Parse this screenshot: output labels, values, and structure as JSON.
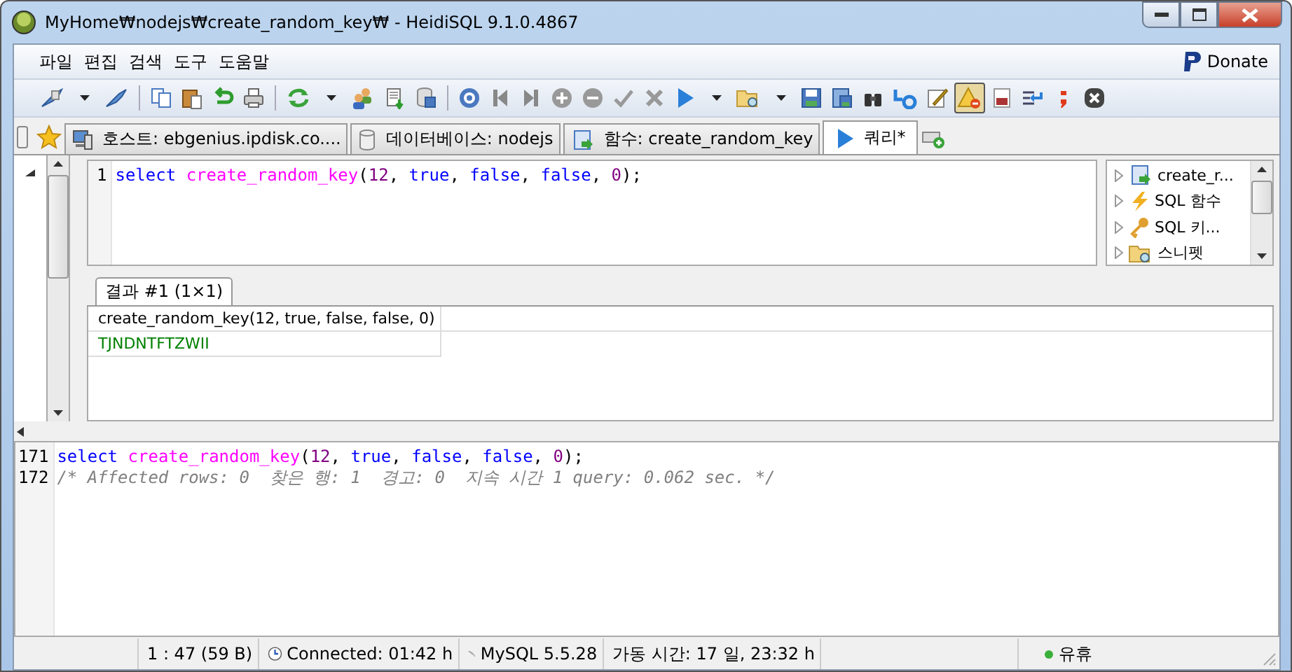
{
  "window": {
    "title": "MyHome₩nodejs₩create_random_key₩ - HeidiSQL 9.1.0.4867"
  },
  "menu": [
    "파일",
    "편집",
    "검색",
    "도구",
    "도움말"
  ],
  "donate": "Donate",
  "toolbar": [
    {
      "kind": "connect",
      "pressed": false
    },
    {
      "kind": "dropdown",
      "pressed": false
    },
    {
      "kind": "disconnect",
      "pressed": false
    },
    {
      "kind": "separator"
    },
    {
      "kind": "copy",
      "pressed": false
    },
    {
      "kind": "paste",
      "pressed": false
    },
    {
      "kind": "undo",
      "pressed": false
    },
    {
      "kind": "print",
      "pressed": false
    },
    {
      "kind": "separator"
    },
    {
      "kind": "refresh",
      "pressed": false
    },
    {
      "kind": "dropdown",
      "pressed": false
    },
    {
      "kind": "users",
      "pressed": false
    },
    {
      "kind": "export",
      "pressed": false
    },
    {
      "kind": "import",
      "pressed": false
    },
    {
      "kind": "separator"
    },
    {
      "kind": "help",
      "pressed": false
    },
    {
      "kind": "first",
      "pressed": false
    },
    {
      "kind": "last",
      "pressed": false
    },
    {
      "kind": "add",
      "pressed": false
    },
    {
      "kind": "remove",
      "pressed": false
    },
    {
      "kind": "check",
      "pressed": false
    },
    {
      "kind": "cancel",
      "pressed": false
    },
    {
      "kind": "run",
      "pressed": false
    },
    {
      "kind": "dropdown",
      "pressed": false
    },
    {
      "kind": "folder",
      "pressed": false
    },
    {
      "kind": "dropdown",
      "pressed": false
    },
    {
      "kind": "save",
      "pressed": false
    },
    {
      "kind": "saveas",
      "pressed": false
    },
    {
      "kind": "binoculars",
      "pressed": false
    },
    {
      "kind": "replace",
      "pressed": false
    },
    {
      "kind": "pencil",
      "pressed": false
    },
    {
      "kind": "warning",
      "pressed": true
    },
    {
      "kind": "hex",
      "pressed": false
    },
    {
      "kind": "wrap",
      "pressed": false
    },
    {
      "kind": "semicolon",
      "pressed": false
    },
    {
      "kind": "stop",
      "pressed": false
    }
  ],
  "tabs": [
    {
      "kind": "host",
      "label": "호스트: ebgenius.ipdisk.co....",
      "selected": false
    },
    {
      "kind": "database",
      "label": "데이터베이스: nodejs",
      "selected": false
    },
    {
      "kind": "function",
      "label": "함수: create_random_key",
      "selected": false
    },
    {
      "kind": "query",
      "label": "쿼리*",
      "selected": true
    }
  ],
  "editor": {
    "lines": [
      {
        "number": "1",
        "tokens": [
          {
            "kind": "keyword",
            "text": "select "
          },
          {
            "kind": "function",
            "text": "create_random_key"
          },
          {
            "kind": "plain",
            "text": "("
          },
          {
            "kind": "number",
            "text": "12"
          },
          {
            "kind": "plain",
            "text": ", "
          },
          {
            "kind": "keyword",
            "text": "true"
          },
          {
            "kind": "plain",
            "text": ", "
          },
          {
            "kind": "keyword",
            "text": "false"
          },
          {
            "kind": "plain",
            "text": ", "
          },
          {
            "kind": "keyword",
            "text": "false"
          },
          {
            "kind": "plain",
            "text": ", "
          },
          {
            "kind": "number",
            "text": "0"
          },
          {
            "kind": "plain",
            "text": ");"
          }
        ]
      }
    ]
  },
  "helpers": [
    {
      "kind": "function",
      "label": "create_r...",
      "expanded": false
    },
    {
      "kind": "bolt",
      "label": "SQL 함수",
      "expanded": false
    },
    {
      "kind": "key",
      "label": "SQL 키...",
      "expanded": false
    },
    {
      "kind": "folder",
      "label": "스니펫",
      "expanded": false
    }
  ],
  "result_tab": {
    "label": "결과 #1 (1×1)"
  },
  "table": {
    "columns": [
      "create_random_key(12, true, false, false, 0)"
    ],
    "rows": [
      [
        "TJNDNTFTZWII"
      ]
    ]
  },
  "log": [
    {
      "number": "171",
      "tokens": [
        {
          "kind": "keyword",
          "text": "select "
        },
        {
          "kind": "function",
          "text": "create_random_key"
        },
        {
          "kind": "plain",
          "text": "("
        },
        {
          "kind": "number",
          "text": "12"
        },
        {
          "kind": "plain",
          "text": ", "
        },
        {
          "kind": "keyword",
          "text": "true"
        },
        {
          "kind": "plain",
          "text": ", "
        },
        {
          "kind": "keyword",
          "text": "false"
        },
        {
          "kind": "plain",
          "text": ", "
        },
        {
          "kind": "keyword",
          "text": "false"
        },
        {
          "kind": "plain",
          "text": ", "
        },
        {
          "kind": "number",
          "text": "0"
        },
        {
          "kind": "plain",
          "text": ");"
        }
      ]
    },
    {
      "number": "172",
      "tokens": [
        {
          "kind": "comment",
          "text": "/* Affected rows: 0  찾은 행: 1  경고: 0  지속 시간 1 query: 0.062 sec. */"
        }
      ]
    }
  ],
  "status_bar": [
    {
      "kind": "text",
      "text": "1 : 47 (59 B)"
    },
    {
      "kind": "clock",
      "text": "Connected: 01:42 h"
    },
    {
      "kind": "server",
      "text": "MySQL 5.5.28"
    },
    {
      "kind": "text",
      "text": "가동 시간: 17 일, 23:32 h"
    },
    {
      "kind": "empty"
    },
    {
      "kind": "idle",
      "text": "유휴"
    }
  ]
}
